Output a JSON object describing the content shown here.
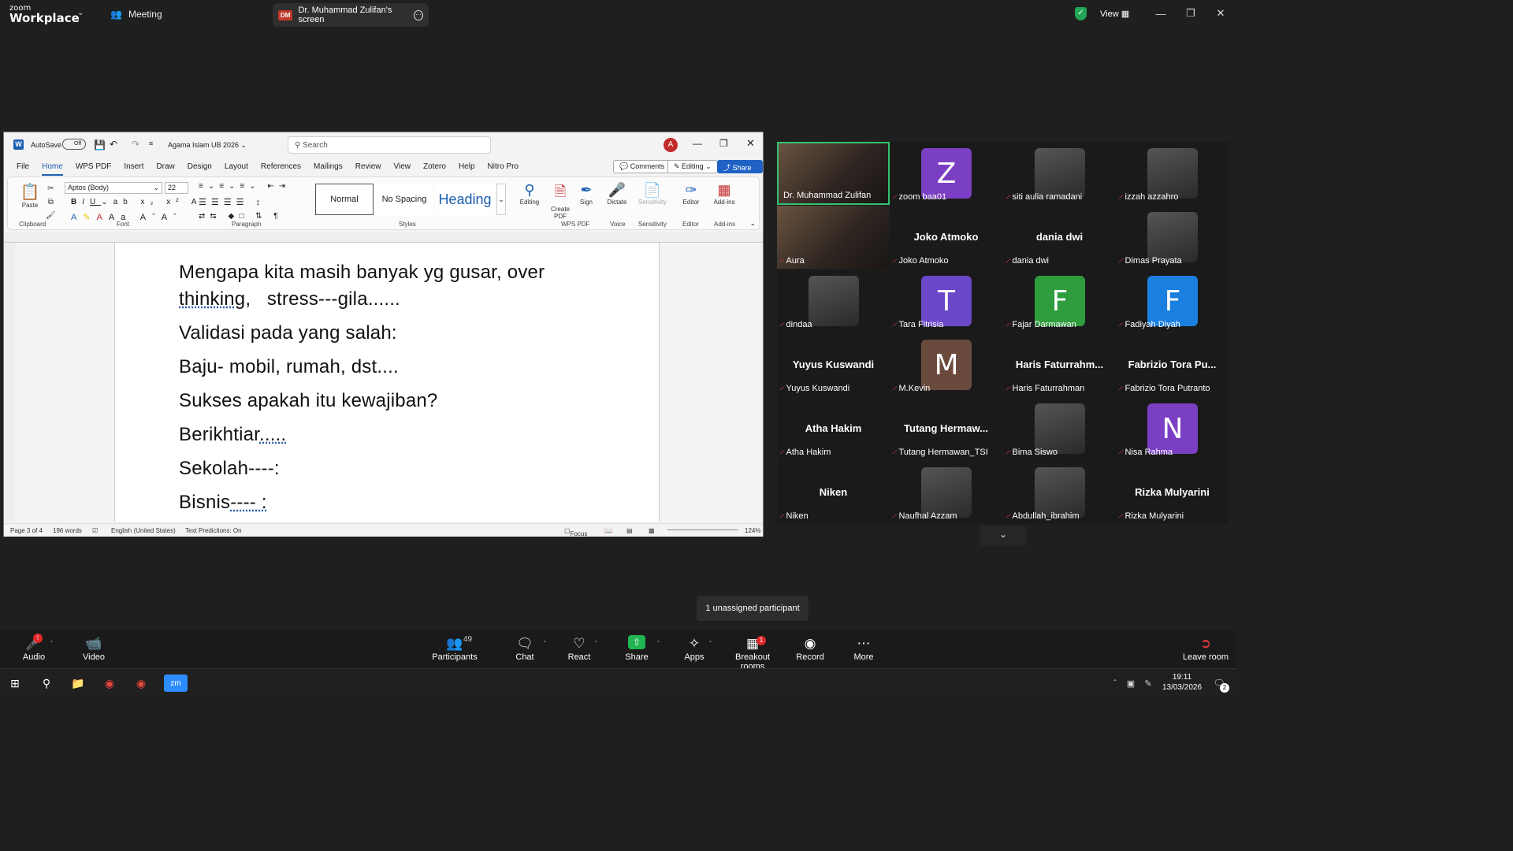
{
  "zoom": {
    "brand_small": "zoom",
    "brand_big": "Workplace",
    "meeting_label": "Meeting",
    "screen_tab": "Dr. Muhammad Zulifan's screen",
    "screen_badge": "DM",
    "view_label": "View"
  },
  "word": {
    "autosave": "AutoSave",
    "autosave_state": "Off",
    "doc_title": "Agama Islam UB 2026",
    "search_placeholder": "Search",
    "avatar": "A",
    "tabs": [
      "File",
      "Home",
      "WPS PDF",
      "Insert",
      "Draw",
      "Design",
      "Layout",
      "References",
      "Mailings",
      "Review",
      "View",
      "Zotero",
      "Help",
      "Nitro Pro"
    ],
    "comments": "Comments",
    "editing": "Editing",
    "share": "Share",
    "font_name": "Aptos (Body)",
    "font_size": "22",
    "styles": [
      "Normal",
      "No Spacing",
      "Heading"
    ],
    "groups": {
      "clipboard": "Clipboard",
      "font": "Font",
      "paragraph": "Paragraph",
      "styles": "Styles",
      "wps_pdf": "WPS PDF",
      "voice": "Voice",
      "sensitivity": "Sensitivity",
      "editor": "Editor",
      "addins": "Add-ins"
    },
    "buttons": {
      "paste": "Paste",
      "editing": "Editing",
      "create_pdf": "Create PDF",
      "sign": "Sign",
      "dictate": "Dictate",
      "sensitivity": "Sensitivity",
      "editor": "Editor",
      "addins": "Add-ins"
    },
    "document_lines": [
      "Mengapa kita masih banyak yg gusar, over",
      "thinking,",
      "stress---gila......",
      "Validasi pada yang salah:",
      "Baju- mobil, rumah, dst....",
      "Sukses apakah itu kewajiban?",
      "Berikhtiar",
      ".....",
      "Sekolah----:",
      "Bisnis",
      "---- :"
    ],
    "status": {
      "page": "Page 3 of 4",
      "words": "196 words",
      "language": "English (United States)",
      "predictions": "Text Predictions: On",
      "focus": "Focus",
      "zoom": "124%"
    }
  },
  "participants": [
    {
      "name": "Dr. Muhammad Zulifan",
      "type": "video",
      "active": true
    },
    {
      "name": "zoom baa01",
      "type": "avatar",
      "letter": "Z",
      "color": "#7b3fc4"
    },
    {
      "name": "siti aulia ramadani",
      "type": "photo"
    },
    {
      "name": "izzah azzahro",
      "type": "photo"
    },
    {
      "name": "Aura",
      "type": "video"
    },
    {
      "name": "Joko Atmoko",
      "type": "text",
      "big": "Joko Atmoko"
    },
    {
      "name": "dania dwi",
      "type": "text",
      "big": "dania dwi"
    },
    {
      "name": "Dimas Prayata",
      "type": "photo"
    },
    {
      "name": "dindaa",
      "type": "photo"
    },
    {
      "name": "Tara Fitrisia",
      "type": "avatar",
      "letter": "T",
      "color": "#6b47c9"
    },
    {
      "name": "Fajar Darmawan",
      "type": "avatar",
      "letter": "F",
      "color": "#2f9c3e"
    },
    {
      "name": "Fadiyah Diyah",
      "type": "avatar",
      "letter": "F",
      "color": "#1b7fe0"
    },
    {
      "name": "Yuyus Kuswandi",
      "type": "text",
      "big": "Yuyus Kuswandi"
    },
    {
      "name": "M.Kevin",
      "type": "avatar",
      "letter": "M",
      "color": "#6b4a3e"
    },
    {
      "name": "Haris Faturrahman",
      "type": "text",
      "big": "Haris Faturrahm..."
    },
    {
      "name": "Fabrizio Tora Putranto",
      "type": "text",
      "big": "Fabrizio Tora Pu..."
    },
    {
      "name": "Atha Hakim",
      "type": "text",
      "big": "Atha Hakim"
    },
    {
      "name": "Tutang Hermawan_TSI",
      "type": "text",
      "big": "Tutang Hermaw..."
    },
    {
      "name": "Bima Siswo",
      "type": "photo"
    },
    {
      "name": "Nisa Rahma",
      "type": "avatar",
      "letter": "N",
      "color": "#7b3fc4"
    },
    {
      "name": "Niken",
      "type": "text",
      "big": "Niken"
    },
    {
      "name": "Naufhal Azzam",
      "type": "photo"
    },
    {
      "name": "Abdullah_ibrahim",
      "type": "photo"
    },
    {
      "name": "Rizka Mulyarini",
      "type": "text",
      "big": "Rizka Mulyarini"
    }
  ],
  "unassigned": "1 unassigned participant",
  "toolbar": {
    "audio": "Audio",
    "video": "Video",
    "participants": "Participants",
    "participants_count": "49",
    "chat": "Chat",
    "react": "React",
    "share": "Share",
    "apps": "Apps",
    "breakout": "Breakout rooms",
    "breakout_badge": "1",
    "record": "Record",
    "more": "More",
    "leave": "Leave room"
  },
  "taskbar": {
    "time": "19:11",
    "date": "13/03/2026",
    "notif": "2"
  }
}
